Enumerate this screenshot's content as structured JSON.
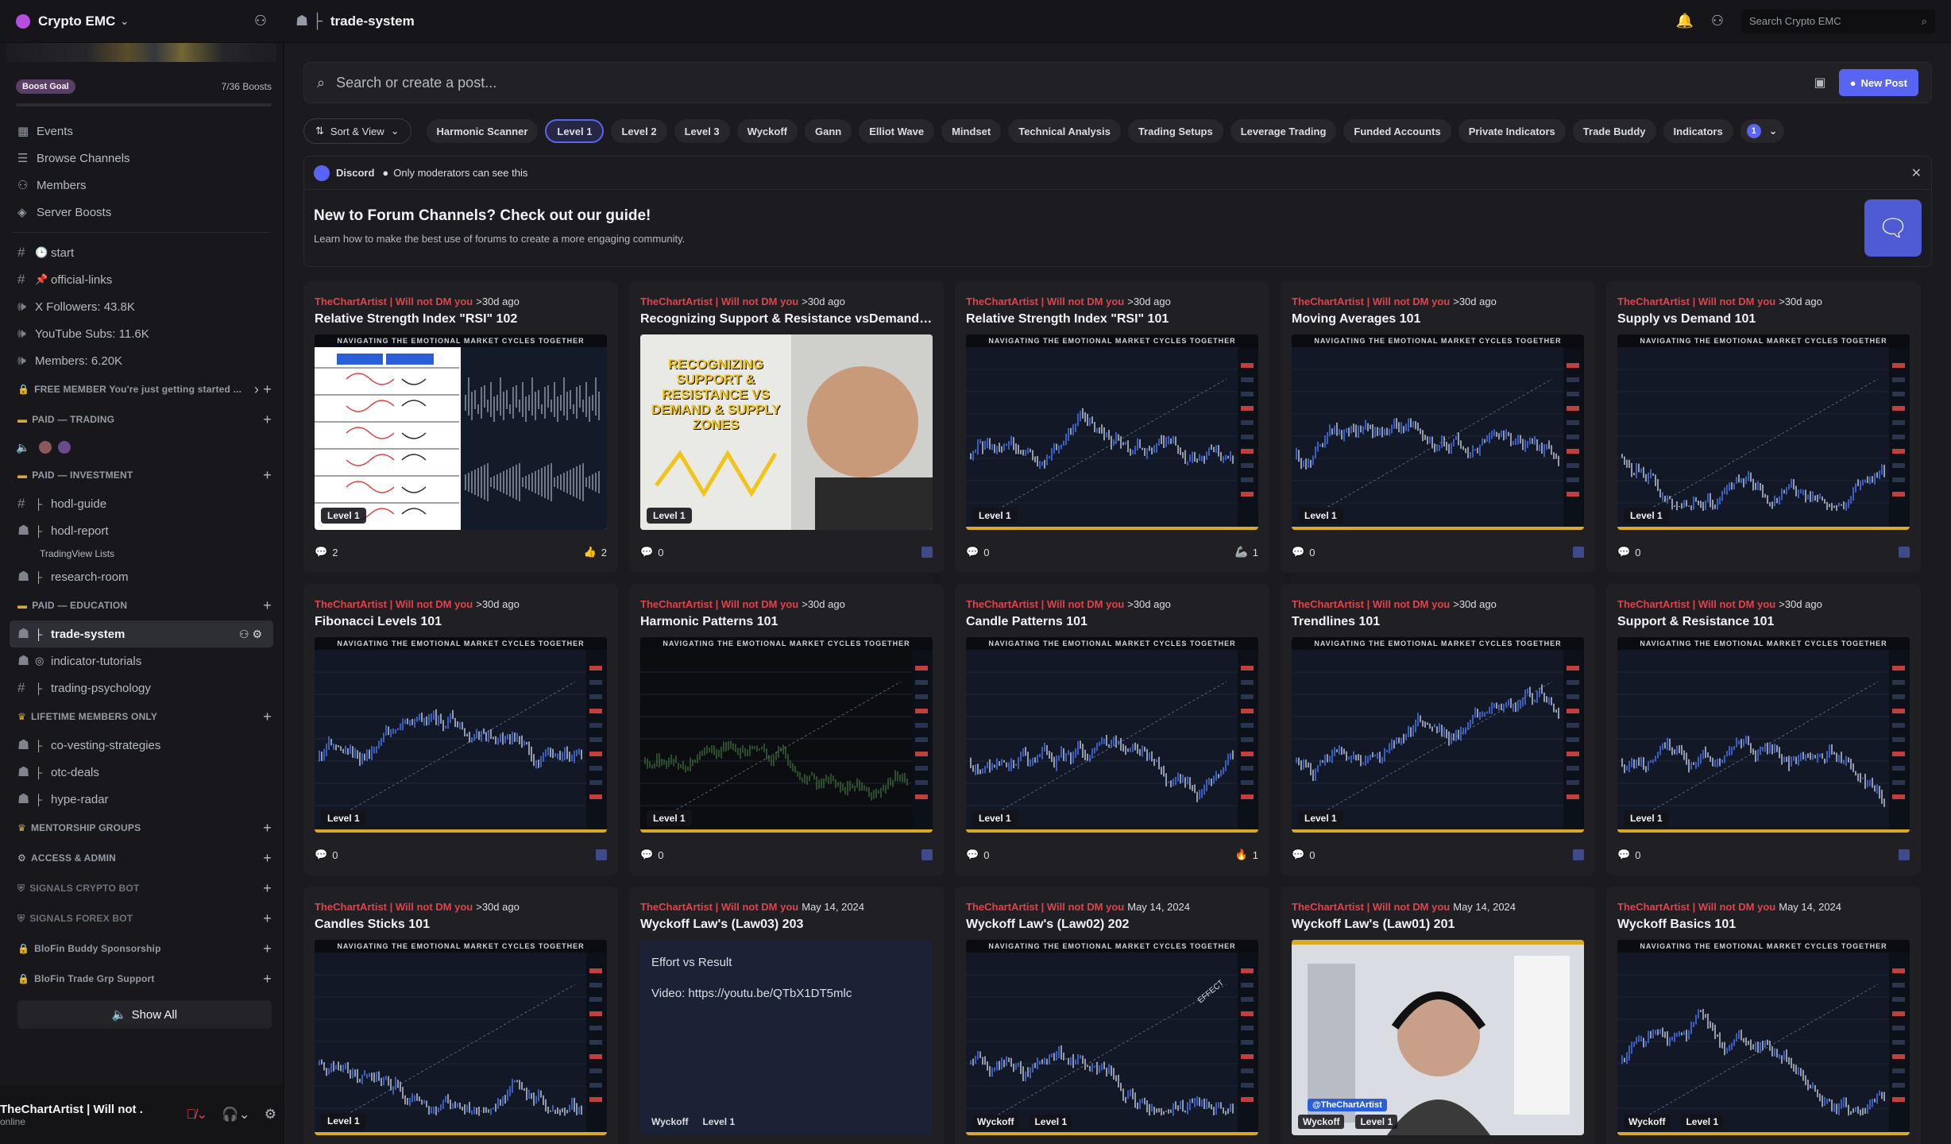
{
  "server": {
    "name": "Crypto EMC"
  },
  "channel": {
    "name": "trade-system"
  },
  "top_search": {
    "placeholder": "Search Crypto EMC"
  },
  "boost": {
    "label": "Boost Goal",
    "count": "7/36 Boosts"
  },
  "nav": [
    {
      "icon": "calendar-icon",
      "label": "Events"
    },
    {
      "icon": "browse-channels-icon",
      "label": "Browse Channels"
    },
    {
      "icon": "members-icon",
      "label": "Members"
    },
    {
      "icon": "boost-icon",
      "label": "Server Boosts"
    }
  ],
  "channels_top": [
    {
      "label": "start"
    },
    {
      "label": "official-links"
    },
    {
      "label": "X Followers: 43.8K"
    },
    {
      "label": "YouTube Subs: 11.6K"
    },
    {
      "label": "Members: 6.20K"
    }
  ],
  "categories": {
    "free": "FREE MEMBER You're just getting started ...",
    "trading": "PAID — TRADING",
    "investment": "PAID — INVESTMENT",
    "education": "PAID — EDUCATION",
    "lifetime": "LIFETIME MEMBERS ONLY",
    "mentorship": "MENTORSHIP GROUPS",
    "access": "ACCESS & ADMIN",
    "crypto_bot": "SIGNALS CRYPTO BOT",
    "forex_bot": "SIGNALS FOREX BOT",
    "blofin_buddy": "BloFin Buddy Sponsorship",
    "blofin_trade": "BloFin Trade Grp Support"
  },
  "investment_channels": [
    {
      "label": "hodl-guide"
    },
    {
      "label": "hodl-report"
    },
    {
      "label": "research-room"
    }
  ],
  "tradingview_sub": "TradingView Lists",
  "education_channels": [
    {
      "label": "trade-system"
    },
    {
      "label": "indicator-tutorials"
    },
    {
      "label": "trading-psychology"
    }
  ],
  "lifetime_channels": [
    {
      "label": "co-vesting-strategies"
    },
    {
      "label": "otc-deals"
    },
    {
      "label": "hype-radar"
    }
  ],
  "show_all": "Show All",
  "user": {
    "name": "TheChartArtist | Will not ...",
    "status": "online"
  },
  "forum_search": {
    "placeholder": "Search or create a post..."
  },
  "new_post": "New Post",
  "sort_view": "Sort & View",
  "tags": [
    "Harmonic Scanner",
    "Level 1",
    "Level 2",
    "Level 3",
    "Wyckoff",
    "Gann",
    "Elliot Wave",
    "Mindset",
    "Technical Analysis",
    "Trading Setups",
    "Leverage Trading",
    "Funded Accounts",
    "Private Indicators",
    "Trade Buddy",
    "Indicators"
  ],
  "selected_tag_count": "1",
  "notice": {
    "app": "Discord",
    "visibility": "Only moderators can see this",
    "title": "New to Forum Channels? Check out our guide!",
    "desc": "Learn how to make the best use of forums to create a more engaging community."
  },
  "band_text": "NAVIGATING THE EMOTIONAL MARKET CYCLES TOGETHER",
  "level_tag": "Level 1",
  "posts": [
    {
      "author": "TheChartArtist | Will not DM you",
      "ago": ">30d ago",
      "title": "Relative Strength Index \"RSI\" 102",
      "comments": "2",
      "reaction": "👍",
      "reaction_count": "2",
      "thumb": "table"
    },
    {
      "author": "TheChartArtist | Will not DM you",
      "ago": ">30d ago",
      "title": "Recognizing Support & Resistance vsDemand & Su...",
      "comments": "0",
      "reaction": "",
      "reaction_count": "",
      "thumb": "face",
      "thumb_text": "RECOGNIZING SUPPORT & RESISTANCE VS DEMAND & SUPPLY ZONES"
    },
    {
      "author": "TheChartArtist | Will not DM you",
      "ago": ">30d ago",
      "title": "Relative Strength Index \"RSI\" 101",
      "comments": "0",
      "reaction": "🦾",
      "reaction_count": "1",
      "thumb": "chart"
    },
    {
      "author": "TheChartArtist | Will not DM you",
      "ago": ">30d ago",
      "title": "Moving Averages 101",
      "comments": "0",
      "reaction": "",
      "reaction_count": "",
      "thumb": "chart"
    },
    {
      "author": "TheChartArtist | Will not DM you",
      "ago": ">30d ago",
      "title": "Supply vs Demand 101",
      "comments": "0",
      "reaction": "",
      "reaction_count": "",
      "thumb": "chart"
    },
    {
      "author": "TheChartArtist | Will not DM you",
      "ago": ">30d ago",
      "title": "Fibonacci Levels 101",
      "comments": "0",
      "reaction": "",
      "reaction_count": "",
      "thumb": "chart"
    },
    {
      "author": "TheChartArtist | Will not DM you",
      "ago": ">30d ago",
      "title": "Harmonic Patterns 101",
      "comments": "0",
      "reaction": "",
      "reaction_count": "",
      "thumb": "chart"
    },
    {
      "author": "TheChartArtist | Will not DM you",
      "ago": ">30d ago",
      "title": "Candle Patterns 101",
      "comments": "0",
      "reaction": "🔥",
      "reaction_count": "1",
      "thumb": "chart"
    },
    {
      "author": "TheChartArtist | Will not DM you",
      "ago": ">30d ago",
      "title": "Trendlines 101",
      "comments": "0",
      "reaction": "",
      "reaction_count": "",
      "thumb": "chart"
    },
    {
      "author": "TheChartArtist | Will not DM you",
      "ago": ">30d ago",
      "title": "Support & Resistance 101",
      "comments": "0",
      "reaction": "",
      "reaction_count": "",
      "thumb": "chart"
    },
    {
      "author": "TheChartArtist | Will not DM you",
      "ago": ">30d ago",
      "title": "Candles Sticks 101",
      "comments": "",
      "reaction": "",
      "reaction_count": "",
      "thumb": "chart"
    },
    {
      "author": "TheChartArtist | Will not DM you",
      "ago": "May 14, 2024",
      "title": "Wyckoff Law's (Law03) 203",
      "comments": "",
      "reaction": "",
      "reaction_count": "",
      "thumb": "text",
      "lines": [
        "Effort vs Result",
        "Video: https://youtu.be/QTbX1DT5mlc"
      ],
      "tags": [
        "Wyckoff",
        "Level 1"
      ]
    },
    {
      "author": "TheChartArtist | Will not DM you",
      "ago": "May 14, 2024",
      "title": "Wyckoff Law's (Law02) 202",
      "comments": "",
      "reaction": "",
      "reaction_count": "",
      "thumb": "chart",
      "tags": [
        "Wyckoff",
        "Level 1"
      ],
      "thumb_text": "EFFECT"
    },
    {
      "author": "TheChartArtist | Will not DM you",
      "ago": "May 14, 2024",
      "title": "Wyckoff Law's (Law01) 201",
      "comments": "",
      "reaction": "",
      "reaction_count": "",
      "thumb": "video",
      "tags": [
        "Wyckoff",
        "Level 1"
      ],
      "thumb_text": "@TheChartArtist"
    },
    {
      "author": "TheChartArtist | Will not DM you",
      "ago": "May 14, 2024",
      "title": "Wyckoff Basics 101",
      "comments": "",
      "reaction": "",
      "reaction_count": "",
      "thumb": "chart",
      "tags": [
        "Wyckoff",
        "Level 1"
      ]
    }
  ],
  "colors": {
    "accent": "#5865f2",
    "author": "#e0434a",
    "gold": "#d9a92a"
  }
}
